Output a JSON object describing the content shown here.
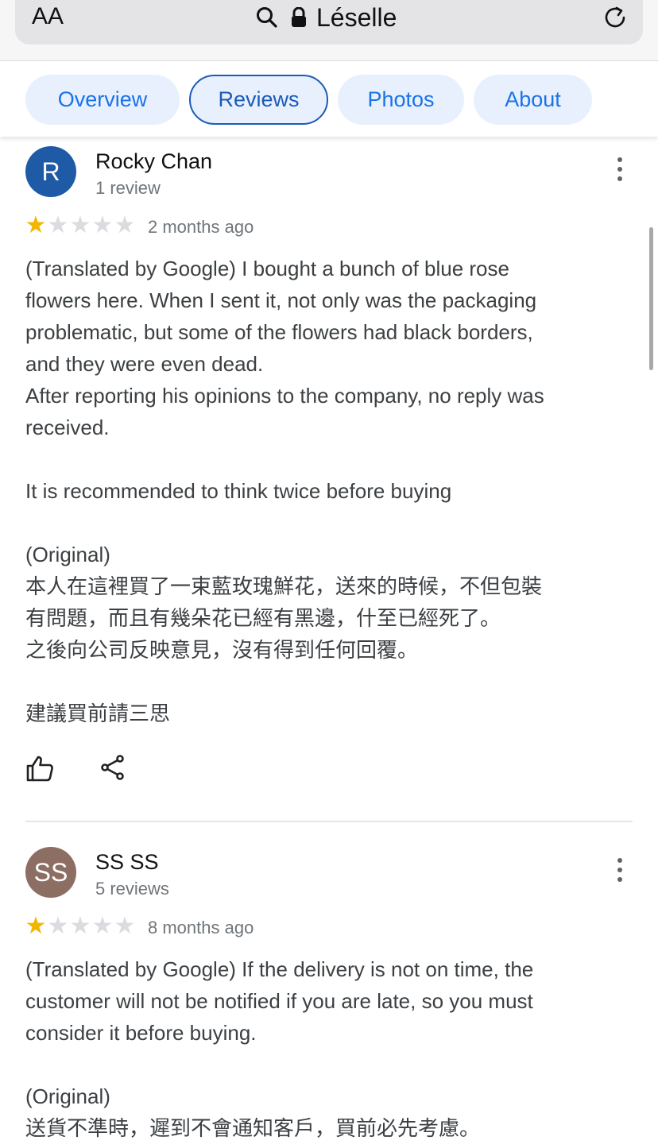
{
  "browser": {
    "text_size_label": "AA",
    "site_title": "Léselle"
  },
  "tabs": [
    {
      "label": "Overview",
      "active": false
    },
    {
      "label": "Reviews",
      "active": true
    },
    {
      "label": "Photos",
      "active": false
    },
    {
      "label": "About",
      "active": false
    }
  ],
  "reviews": [
    {
      "avatar_letter": "R",
      "avatar_color": "#1f5aa6",
      "name": "Rocky Chan",
      "review_count": "1 review",
      "rating": 1,
      "time": "2 months ago",
      "text": {
        "l1": "(Translated by Google) I bought a bunch of blue rose",
        "l2": "flowers here. When I sent it, not only was the packaging",
        "l3": "problematic, but some of the flowers had black borders,",
        "l4": "and they were even dead.",
        "l5": "After reporting his opinions to the company, no reply was",
        "l6": "received.",
        "l7": "It is recommended to think twice before buying",
        "l8": "(Original)",
        "l9": "本人在這裡買了一束藍玫瑰鮮花，送來的時候，不但包裝",
        "l10": "有問題，而且有幾朵花已經有黑邊，什至已經死了。",
        "l11": "之後向公司反映意見，沒有得到任何回覆。",
        "l12": "建議買前請三思"
      }
    },
    {
      "avatar_letter": "SS",
      "avatar_color": "#8d6e63",
      "name": "SS SS",
      "review_count": "5 reviews",
      "rating": 1,
      "time": "8 months ago",
      "text": {
        "l1": "(Translated by Google) If the delivery is not on time, the",
        "l2": "customer will not be notified if you are late, so you must",
        "l3": "consider it before buying.",
        "l4": "(Original)",
        "l5": "送貨不準時，遲到不會通知客戶，買前必先考慮。"
      }
    }
  ],
  "icons": {
    "search": "search-icon",
    "lock": "lock-icon",
    "reload": "reload-icon",
    "like": "thumbs-up-icon",
    "share": "share-icon",
    "more": "more-vert-icon"
  },
  "colors": {
    "accent": "#1a73e8",
    "tab_bg": "#e8f0fe",
    "star_on": "#f2b600",
    "star_off": "#dadce0"
  }
}
